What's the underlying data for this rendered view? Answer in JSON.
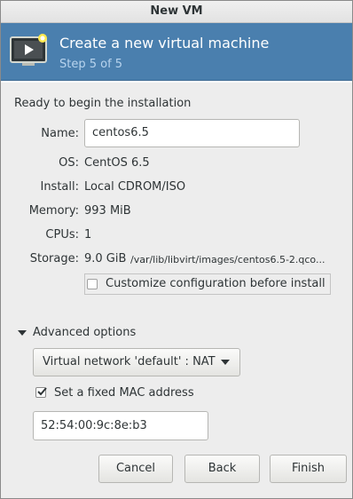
{
  "window": {
    "title": "New VM"
  },
  "banner": {
    "title": "Create a new virtual machine",
    "step": "Step 5 of 5"
  },
  "summary": {
    "heading": "Ready to begin the installation",
    "name_label": "Name:",
    "name_value": "centos6.5",
    "os_label": "OS:",
    "os_value": "CentOS 6.5",
    "install_label": "Install:",
    "install_value": "Local CDROM/ISO",
    "memory_label": "Memory:",
    "memory_value": "993 MiB",
    "cpus_label": "CPUs:",
    "cpus_value": "1",
    "storage_label": "Storage:",
    "storage_size": "9.0 GiB",
    "storage_path": "/var/lib/libvirt/images/centos6.5-2.qco...",
    "customize_label": "Customize configuration before install",
    "customize_checked": false
  },
  "advanced": {
    "expander_label": "Advanced options",
    "network_selected": "Virtual network 'default' : NAT",
    "mac_label": "Set a fixed MAC address",
    "mac_checked": true,
    "mac_value": "52:54:00:9c:8e:b3"
  },
  "buttons": {
    "cancel": "Cancel",
    "back": "Back",
    "finish": "Finish"
  }
}
